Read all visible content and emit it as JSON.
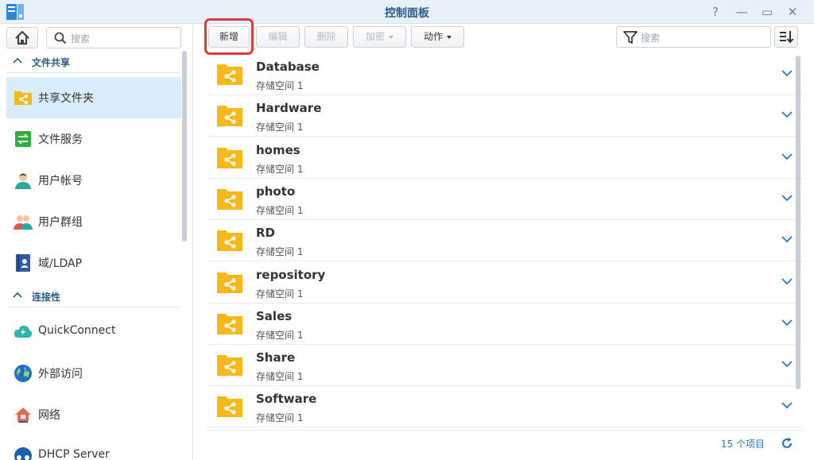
{
  "window": {
    "title": "控制面板",
    "help": "?",
    "minimize": "—",
    "maximize": "▭",
    "close": "✕"
  },
  "sidebar": {
    "search_placeholder": "搜索",
    "sections": [
      {
        "label": "文件共享"
      },
      {
        "label": "连接性"
      }
    ],
    "items": [
      {
        "label": "共享文件夹",
        "icon": "shared-folder-icon",
        "active": true
      },
      {
        "label": "文件服务",
        "icon": "file-services-icon"
      },
      {
        "label": "用户帐号",
        "icon": "user-icon"
      },
      {
        "label": "用户群组",
        "icon": "group-icon"
      },
      {
        "label": "域/LDAP",
        "icon": "ldap-icon"
      },
      {
        "label": "QuickConnect",
        "icon": "quickconnect-icon"
      },
      {
        "label": "外部访问",
        "icon": "globe-icon"
      },
      {
        "label": "网络",
        "icon": "network-icon"
      },
      {
        "label": "DHCP Server",
        "icon": "dhcp-icon"
      }
    ]
  },
  "toolbar": {
    "create": "新增",
    "edit": "编辑",
    "delete": "删除",
    "encrypt": "加密",
    "action": "动作",
    "search_placeholder": "搜索"
  },
  "folders": [
    {
      "name": "Database",
      "volume": "存储空间 1"
    },
    {
      "name": "Hardware",
      "volume": "存储空间 1"
    },
    {
      "name": "homes",
      "volume": "存储空间 1"
    },
    {
      "name": "photo",
      "volume": "存储空间 1"
    },
    {
      "name": "RD",
      "volume": "存储空间 1"
    },
    {
      "name": "repository",
      "volume": "存储空间 1"
    },
    {
      "name": "Sales",
      "volume": "存储空间 1"
    },
    {
      "name": "Share",
      "volume": "存储空间 1"
    },
    {
      "name": "Software",
      "volume": "存储空间 1"
    }
  ],
  "footer": {
    "count": "15 个项目"
  },
  "colors": {
    "accent": "#2a7ac0",
    "folder": "#f8b81c",
    "highlight": "#e23a3a",
    "active_bg": "#d9ecfb"
  }
}
